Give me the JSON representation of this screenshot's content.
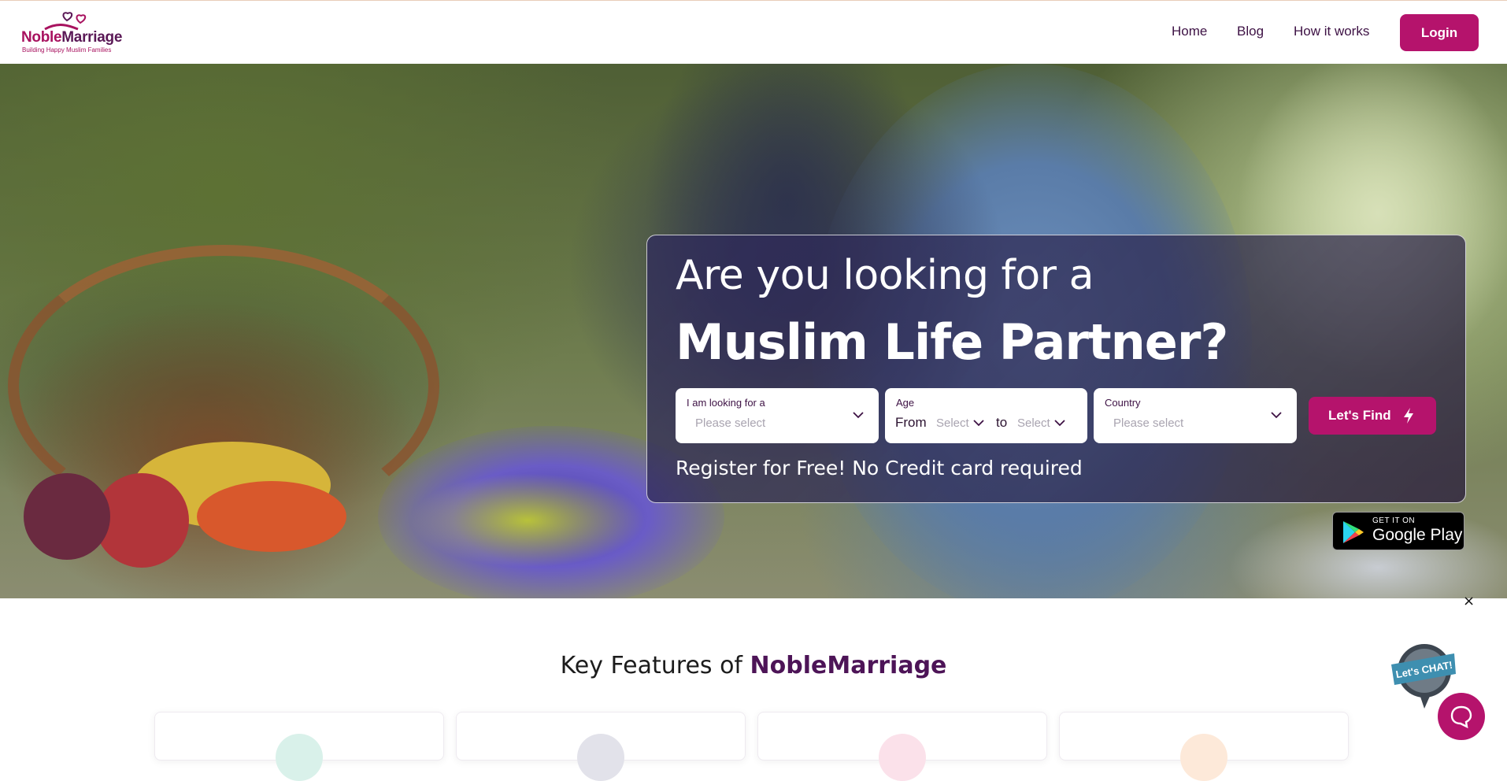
{
  "header": {
    "logo": {
      "brand_part1": "Noble",
      "brand_part2": "Marriage",
      "tagline": "Building Happy Muslim Families",
      "icon": "hearts-icon"
    },
    "nav": [
      {
        "label": "Home"
      },
      {
        "label": "Blog"
      },
      {
        "label": "How it works"
      }
    ],
    "login_label": "Login"
  },
  "hero": {
    "headline_line1": "Are you looking for a",
    "headline_line2": "Muslim Life Partner?",
    "search": {
      "looking_for": {
        "label": "I am looking for a",
        "value": "Please select",
        "icon": "chevron-down-icon"
      },
      "age": {
        "label": "Age",
        "from_word": "From",
        "from_value": "Select",
        "to_word": "to",
        "to_value": "Select"
      },
      "country": {
        "label": "Country",
        "value": "Please select",
        "icon": "chevron-down-icon"
      },
      "submit_label": "Let's Find",
      "submit_icon": "lightning-bolt-icon"
    },
    "register_note": "Register for Free! No Credit card required",
    "store_badge": {
      "line1": "GET IT ON",
      "line2": "Google Play",
      "icon": "google-play-icon"
    }
  },
  "features": {
    "title_prefix": "Key Features of ",
    "title_brand": "NobleMarriage",
    "cards": [
      {
        "circle_color": "#d9f1ea"
      },
      {
        "circle_color": "#e2e2ea"
      },
      {
        "circle_color": "#fbe1ea"
      },
      {
        "circle_color": "#fde9d9"
      }
    ]
  },
  "chat_widget": {
    "badge_text": "Let's CHAT!",
    "close_symbol": "×",
    "icon": "chat-bubble-icon"
  },
  "colors": {
    "brand": "#b5136c",
    "brand_dark": "#4d1457",
    "nav_text": "#3d1144",
    "panel": "#302c5c"
  }
}
